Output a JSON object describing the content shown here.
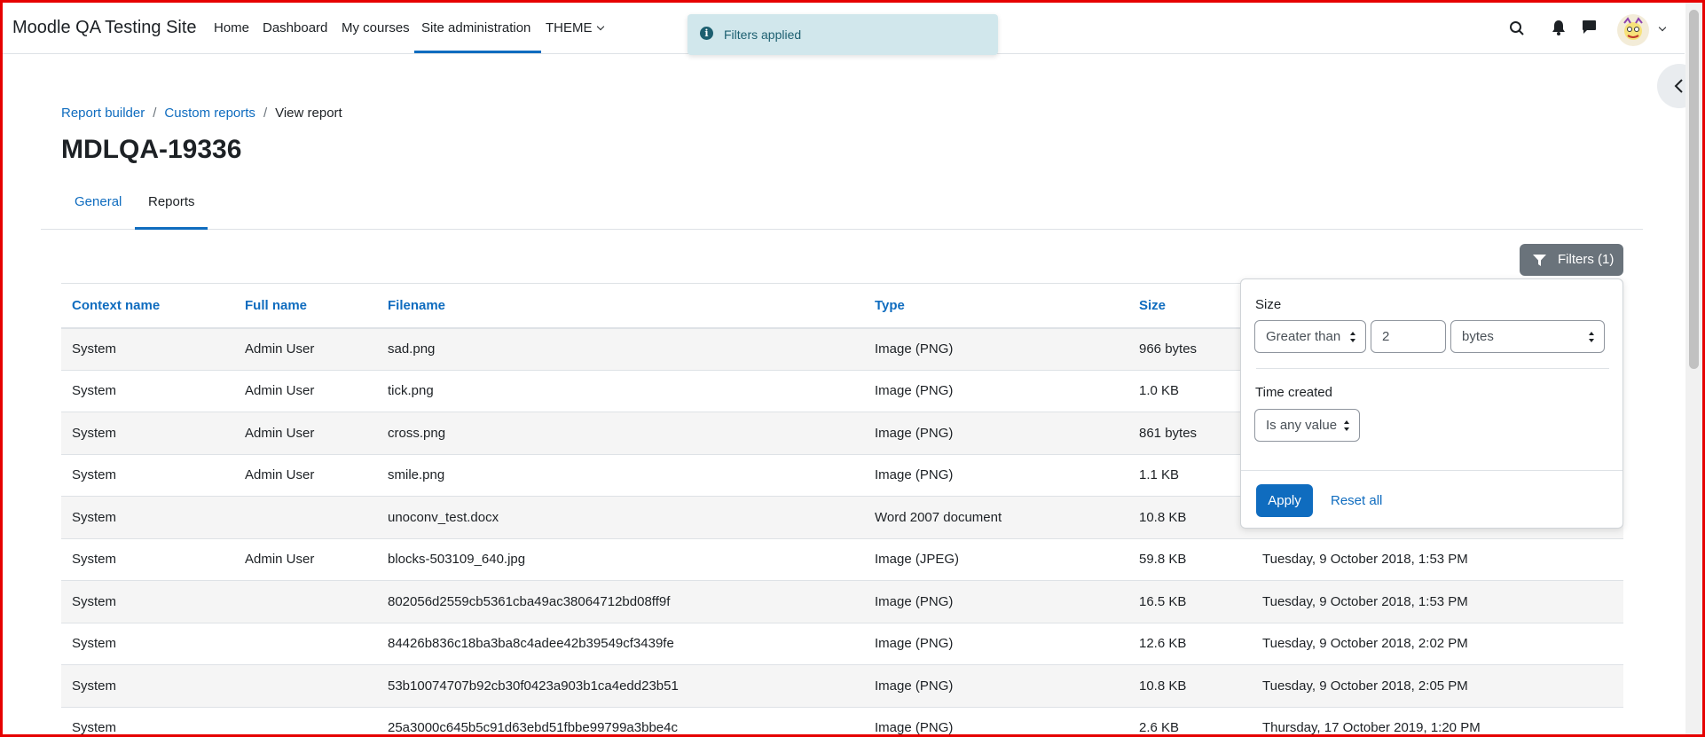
{
  "navbar": {
    "brand": "Moodle QA Testing Site",
    "links": [
      "Home",
      "Dashboard",
      "My courses",
      "Site administration",
      "THEME"
    ],
    "active_link": "Site administration"
  },
  "toast": {
    "message": "Filters applied"
  },
  "breadcrumb": [
    "Report builder",
    "Custom reports",
    "View report"
  ],
  "page_title": "MDLQA-19336",
  "tabs": [
    "General",
    "Reports"
  ],
  "active_tab": "Reports",
  "filters_button": "Filters (1)",
  "table": {
    "headers": [
      "Context name",
      "Full name",
      "Filename",
      "Type",
      "Size",
      ""
    ],
    "rows": [
      [
        "System",
        "Admin User",
        "sad.png",
        "Image (PNG)",
        "966 bytes",
        ""
      ],
      [
        "System",
        "Admin User",
        "tick.png",
        "Image (PNG)",
        "1.0 KB",
        ""
      ],
      [
        "System",
        "Admin User",
        "cross.png",
        "Image (PNG)",
        "861 bytes",
        ""
      ],
      [
        "System",
        "Admin User",
        "smile.png",
        "Image (PNG)",
        "1.1 KB",
        ""
      ],
      [
        "System",
        "",
        "unoconv_test.docx",
        "Word 2007 document",
        "10.8 KB",
        ""
      ],
      [
        "System",
        "Admin User",
        "blocks-503109_640.jpg",
        "Image (JPEG)",
        "59.8 KB",
        "Tuesday, 9 October 2018, 1:53 PM"
      ],
      [
        "System",
        "",
        "802056d2559cb5361cba49ac38064712bd08ff9f",
        "Image (PNG)",
        "16.5 KB",
        "Tuesday, 9 October 2018, 1:53 PM"
      ],
      [
        "System",
        "",
        "84426b836c18ba3ba8c4adee42b39549cf3439fe",
        "Image (PNG)",
        "12.6 KB",
        "Tuesday, 9 October 2018, 2:02 PM"
      ],
      [
        "System",
        "",
        "53b10074707b92cb30f0423a903b1ca4edd23b51",
        "Image (PNG)",
        "10.8 KB",
        "Tuesday, 9 October 2018, 2:05 PM"
      ],
      [
        "System",
        "",
        "25a3000c645b5c91d63ebd51fbbe99799a3bbe4c",
        "Image (PNG)",
        "2.6 KB",
        "Thursday, 17 October 2019, 1:20 PM"
      ]
    ]
  },
  "filter_popover": {
    "size_label": "Size",
    "size_operator": "Greater than",
    "size_value": "2",
    "size_unit": "bytes",
    "time_label": "Time created",
    "time_operator": "Is any value",
    "apply_label": "Apply",
    "reset_label": "Reset all"
  },
  "colors": {
    "primary": "#0f6cbf",
    "toast_bg": "#d1e7ec",
    "filters_btn": "#6a737b"
  }
}
